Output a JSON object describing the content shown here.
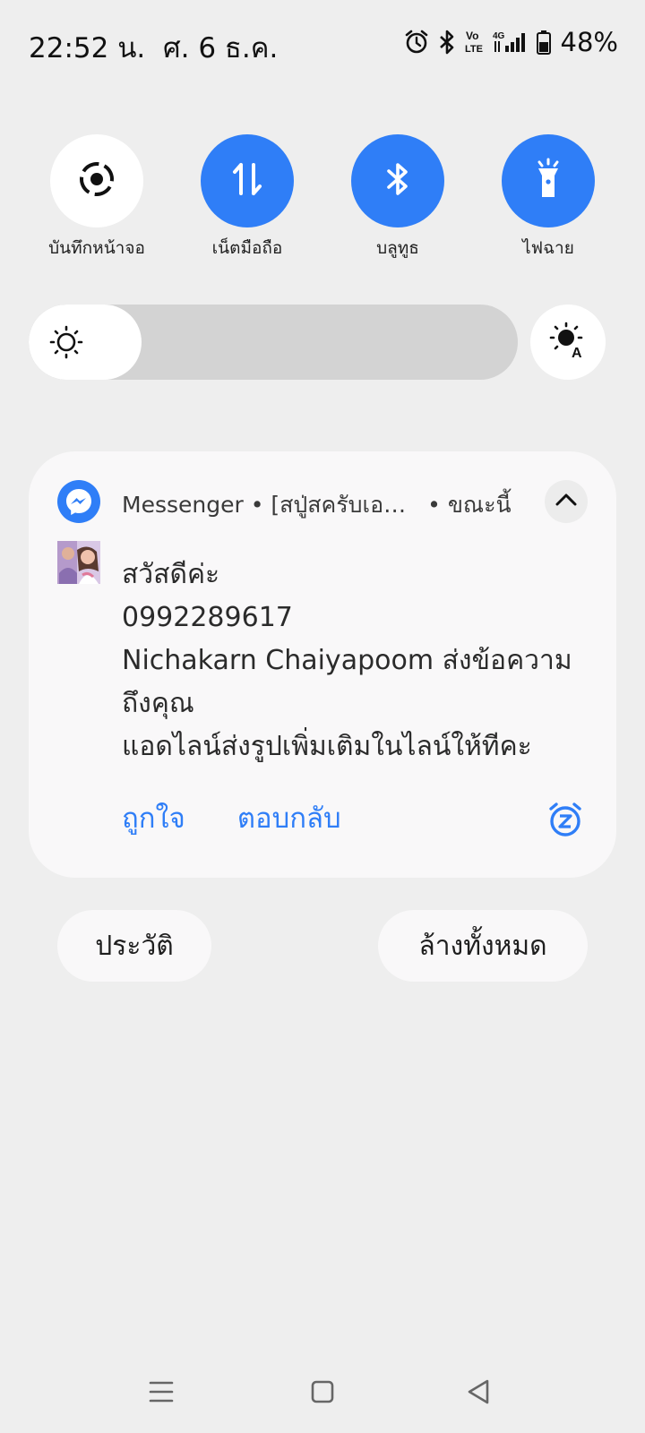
{
  "status_bar": {
    "time": "22:52 น.",
    "date": "ศ. 6 ธ.ค.",
    "network_volte": "Vo LTE",
    "network_type": "4G",
    "battery_percent": "48%",
    "icons": [
      "alarm-icon",
      "bluetooth-icon",
      "volte-icon",
      "signal-icon",
      "battery-icon"
    ]
  },
  "quick_tiles": [
    {
      "label": "บันทึกหน้าจอ",
      "icon": "screen-record-icon",
      "active": false
    },
    {
      "label": "เน็ตมือถือ",
      "icon": "mobile-data-icon",
      "active": true
    },
    {
      "label": "บลูทูธ",
      "icon": "bluetooth-icon",
      "active": true
    },
    {
      "label": "ไฟฉาย",
      "icon": "flashlight-icon",
      "active": true
    }
  ],
  "brightness": {
    "level": 0.23,
    "auto_icon": "auto-brightness-icon"
  },
  "notification": {
    "app_name": "Messenger • [สปู่สครับเอ…",
    "time": "• ขณะนี้",
    "lines": [
      "สวัสดีค่ะ",
      "0992289617",
      "Nichakarn Chaiyapoom ส่งข้อความถึงคุณ",
      "แอดไลน์ส่งรูปเพิ่มเติมในไลน์ให้ทีคะ"
    ],
    "actions": {
      "like": "ถูกใจ",
      "reply": "ตอบกลับ"
    }
  },
  "buttons": {
    "history": "ประวัติ",
    "clear_all": "ล้างทั้งหมด"
  },
  "colors": {
    "accent": "#2f7ef7",
    "background": "#eeeeee",
    "card": "#f9f8f9"
  }
}
